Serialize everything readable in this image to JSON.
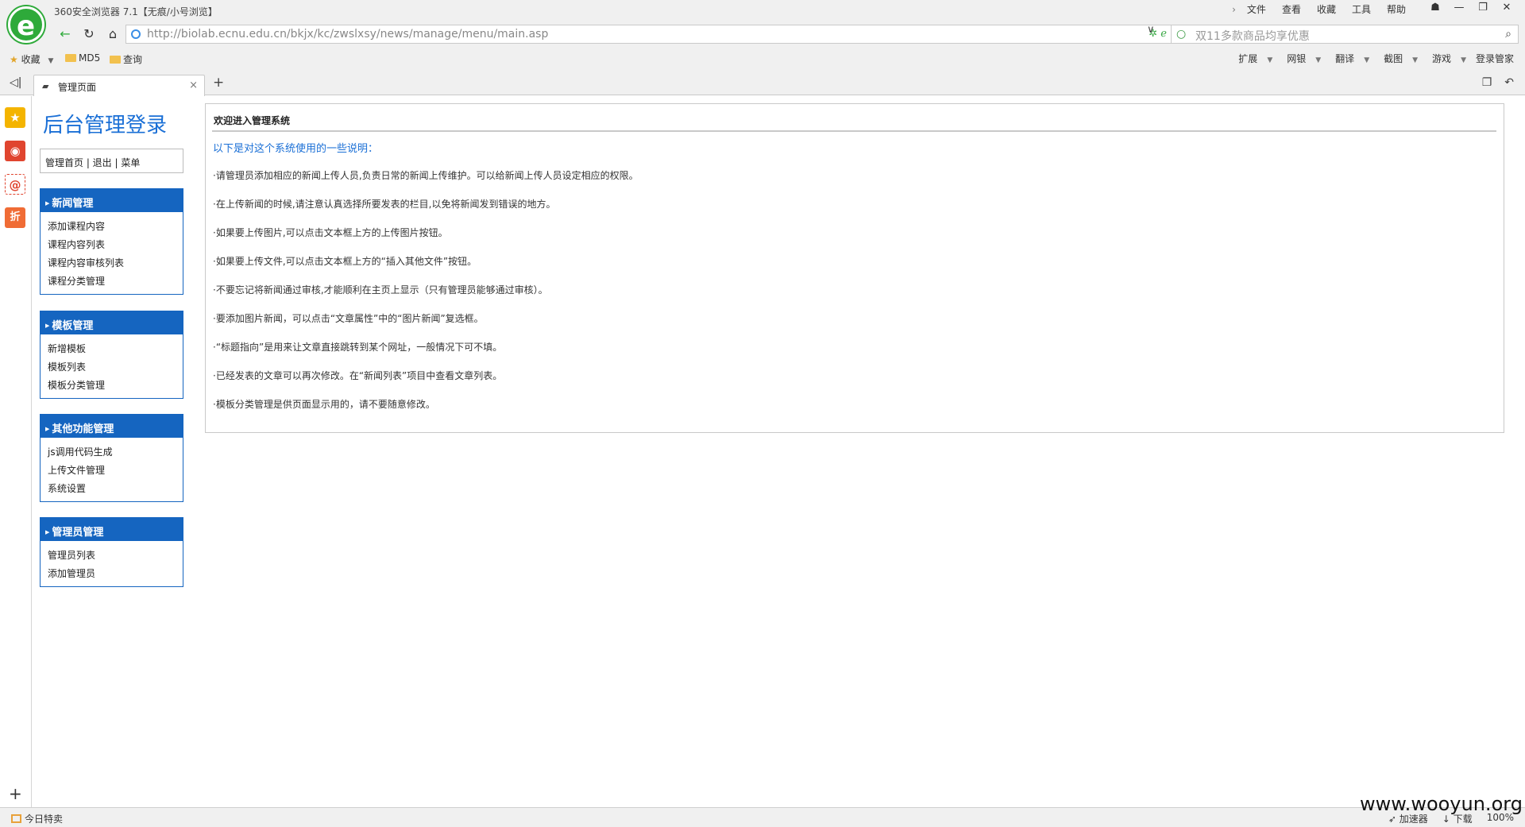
{
  "window": {
    "title": "360安全浏览器 7.1【无痕/小号浏览】",
    "menu": [
      "文件",
      "查看",
      "收藏",
      "工具",
      "帮助"
    ],
    "controls": [
      "☗",
      "—",
      "❐",
      "✕"
    ]
  },
  "nav": {
    "url": "http://biolab.ecnu.edu.cn/bkjx/kc/zwslxsy/news/manage/menu/main.asp",
    "search_placeholder": "双11多款商品均享优惠"
  },
  "bookmarks": {
    "items": [
      "收藏",
      "MD5",
      "查询"
    ],
    "tools": [
      "扩展",
      "网银",
      "翻译",
      "截图",
      "游戏",
      "登录管家"
    ]
  },
  "tabs": [
    {
      "label": "管理页面"
    }
  ],
  "page": {
    "logo": "后台管理登录",
    "quicklinks": "管理首页 | 退出 | 菜单",
    "menu_boxes": [
      {
        "title": "新闻管理",
        "items": [
          "添加课程内容",
          "课程内容列表",
          "课程内容审核列表",
          "课程分类管理"
        ]
      },
      {
        "title": "模板管理",
        "items": [
          "新增模板",
          "模板列表",
          "模板分类管理"
        ]
      },
      {
        "title": "其他功能管理",
        "items": [
          "js调用代码生成",
          "上传文件管理",
          "系统设置"
        ]
      },
      {
        "title": "管理员管理",
        "items": [
          "管理员列表",
          "添加管理员"
        ]
      }
    ],
    "content": {
      "title": "欢迎进入管理系统",
      "intro": "以下是对这个系统使用的一些说明：",
      "tips": [
        "·请管理员添加相应的新闻上传人员,负责日常的新闻上传维护。可以给新闻上传人员设定相应的权限。",
        "·在上传新闻的时候,请注意认真选择所要发表的栏目,以免将新闻发到错误的地方。",
        "·如果要上传图片,可以点击文本框上方的上传图片按钮。",
        "·如果要上传文件,可以点击文本框上方的“插入其他文件”按钮。",
        "·不要忘记将新闻通过审核,才能顺利在主页上显示（只有管理员能够通过审核）。",
        "·要添加图片新闻，可以点击“文章属性”中的“图片新闻”复选框。",
        "·“标题指向”是用来让文章直接跳转到某个网址，一般情况下可不填。",
        "·已经发表的文章可以再次修改。在“新闻列表”项目中查看文章列表。",
        "·模板分类管理是供页面显示用的，请不要随意修改。"
      ]
    }
  },
  "status": {
    "left": "今日特卖",
    "right": [
      "加速器",
      "下载",
      "100%"
    ]
  },
  "watermark": "www.wooyun.org",
  "colors": {
    "accent": "#1565c0",
    "link": "#1a6fd6",
    "brand": "#2eaa3a"
  }
}
